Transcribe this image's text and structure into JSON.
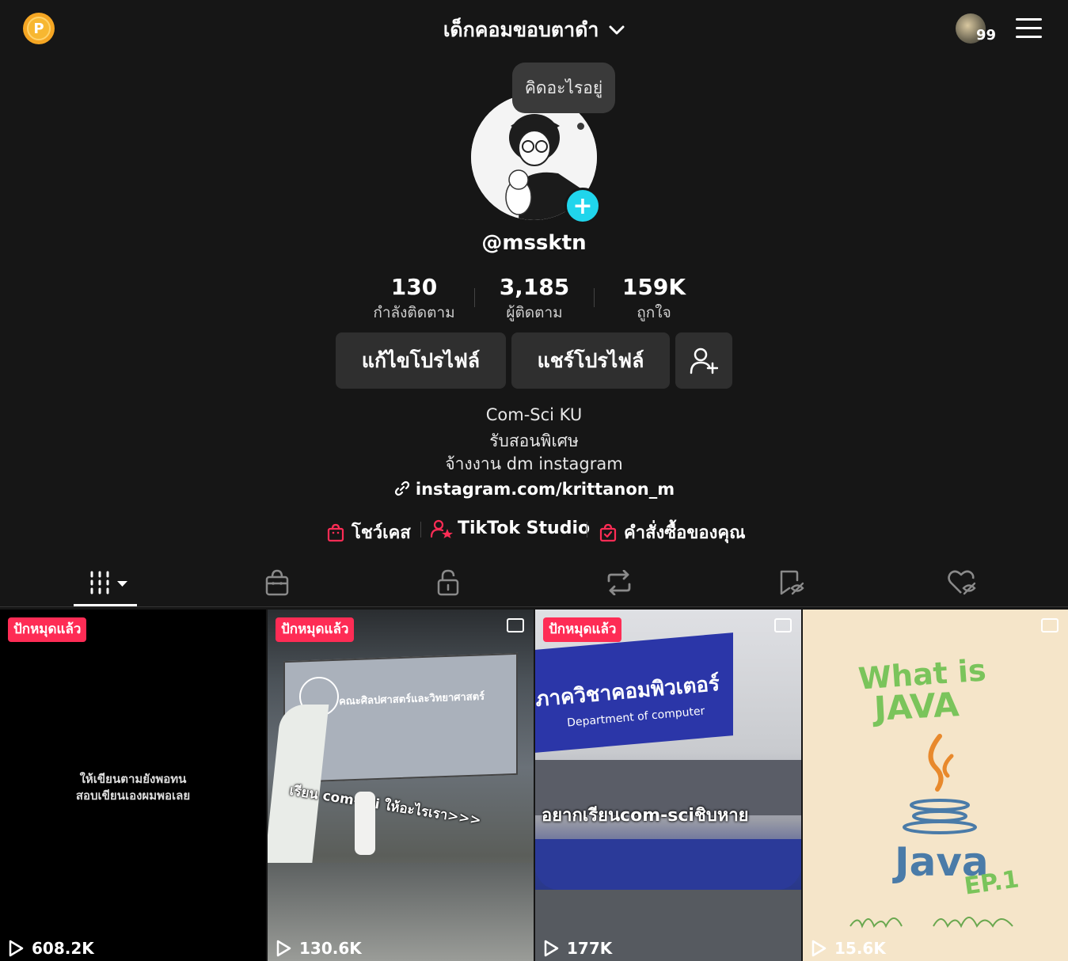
{
  "header": {
    "coin_letter": "P",
    "account_name": "เด็กคอมขอบตาดำ",
    "notification_count": "99"
  },
  "profile": {
    "bubble_text": "คิดอะไรอยู่",
    "handle": "@mssktn",
    "stats": [
      {
        "value": "130",
        "label": "กำลังติดตาม"
      },
      {
        "value": "3,185",
        "label": "ผู้ติดตาม"
      },
      {
        "value": "159K",
        "label": "ถูกใจ"
      }
    ],
    "buttons": {
      "edit": "แก้ไขโปรไฟล์",
      "share": "แชร์โปรไฟล์"
    },
    "bio": [
      "Com-Sci KU",
      "รับสอนพิเศษ",
      "จ้างงาน dm instagram"
    ],
    "link": "instagram.com/krittanon_m",
    "quick_links": [
      "โชว์เคส",
      "TikTok Studio",
      "คำสั่งซื้อของคุณ"
    ]
  },
  "tabs": [
    "videos-tab",
    "showcase-tab",
    "private-tab",
    "reposts-tab",
    "favorites-tab",
    "liked-tab"
  ],
  "videos": [
    {
      "pinned": "ปักหมุดแล้ว",
      "views": "608.2K",
      "caption": [
        "ให้เขียนตามยังพอทน",
        "สอบเขียนเองผมพอเลย"
      ],
      "photo": false
    },
    {
      "pinned": "ปักหมุดแล้ว",
      "views": "130.6K",
      "caption": [
        "เรียน com-sci ให้อะไรเรา>>>"
      ],
      "slide_title": "คณะศิลปศาสตร์และวิทยาศาสตร์",
      "photo": true
    },
    {
      "pinned": "ปักหมุดแล้ว",
      "views": "177K",
      "caption": [
        "อยากเรียนcom-sciชิบหาย"
      ],
      "sign_text": "ภาควิชาคอมพิวเตอร์",
      "sign_sub": "Department of computer",
      "photo": true
    },
    {
      "pinned": "",
      "views": "15.6K",
      "caption": [
        "What is",
        "JAVA",
        "Java",
        "EP.1"
      ],
      "photo": true
    }
  ],
  "colors": {
    "accent": "#fe2c55",
    "teal": "#20d5ec",
    "bg": "#161616"
  }
}
